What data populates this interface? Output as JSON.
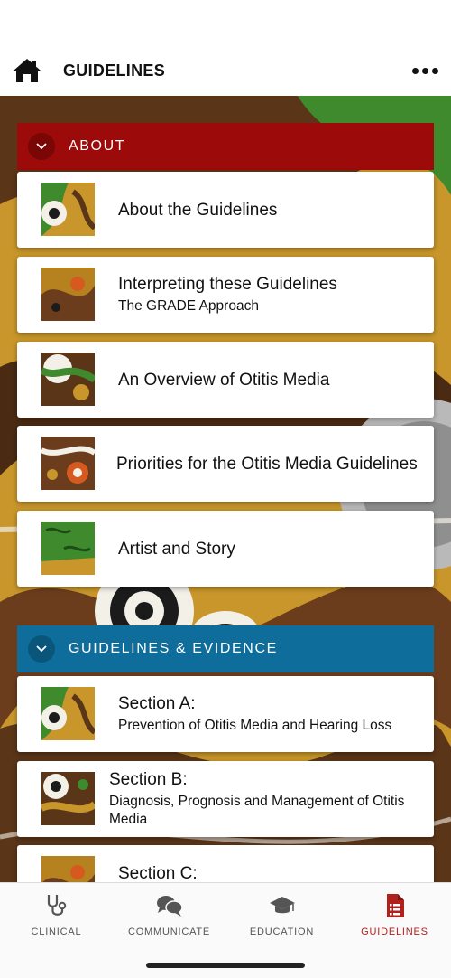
{
  "header": {
    "title": "GUIDELINES"
  },
  "sections": [
    {
      "label": "ABOUT",
      "color": "#9d0a0a",
      "items": [
        {
          "title": "About the Guidelines",
          "subtitle": ""
        },
        {
          "title": "Interpreting these Guidelines",
          "subtitle": "The GRADE Approach"
        },
        {
          "title": "An Overview of Otitis Media",
          "subtitle": ""
        },
        {
          "title": "Priorities for the Otitis Media Guidelines",
          "subtitle": ""
        },
        {
          "title": "Artist and Story",
          "subtitle": ""
        }
      ]
    },
    {
      "label": "GUIDELINES & EVIDENCE",
      "color": "#0e6d9a",
      "items": [
        {
          "title": "Section A:",
          "subtitle": "Prevention of Otitis Media and Hearing Loss"
        },
        {
          "title": "Section B:",
          "subtitle": "Diagnosis, Prognosis and Management of Otitis Media"
        },
        {
          "title": "Section C:",
          "subtitle": ""
        }
      ]
    }
  ],
  "tabs": [
    {
      "label": "CLINICAL",
      "icon": "stethoscope-icon",
      "active": false
    },
    {
      "label": "COMMUNICATE",
      "icon": "chat-bubbles-icon",
      "active": false
    },
    {
      "label": "EDUCATION",
      "icon": "graduation-cap-icon",
      "active": false
    },
    {
      "label": "GUIDELINES",
      "icon": "document-list-icon",
      "active": true
    }
  ],
  "colors": {
    "about_accent": "#9d0a0a",
    "guidelines_accent": "#0e6d9a",
    "active_tab": "#b0211b"
  }
}
